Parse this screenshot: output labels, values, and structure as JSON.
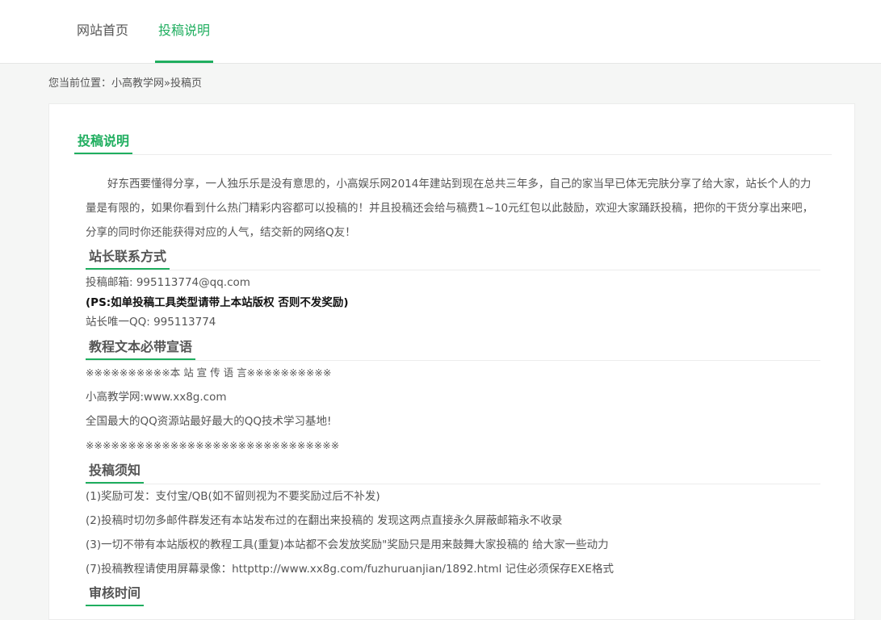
{
  "nav": {
    "items": [
      {
        "label": "网站首页",
        "active": false
      },
      {
        "label": "投稿说明",
        "active": true
      }
    ],
    "accent_color": "#1fae5f"
  },
  "breadcrumb": {
    "prefix": "您当前位置：",
    "home": "小高教学网",
    "separator": "»",
    "current": "投稿页"
  },
  "main_title": "投稿说明",
  "intro": "好东西要懂得分享，一人独乐乐是没有意思的，小高娱乐网2014年建站到现在总共三年多，自己的家当早已体无完肤分享了给大家，站长个人的力量是有限的，如果你看到什么热门精彩内容都可以投稿的！并且投稿还会给与稿费1~10元红包以此鼓励，欢迎大家踊跃投稿，把你的干货分享出来吧，分享的同时你还能获得对应的人气，结交新的网络Q友！",
  "contact": {
    "title": "站长联系方式",
    "email": "投稿邮箱: 995113774@qq.com",
    "note": "(PS:如单投稿工具类型请带上本站版权 否则不发奖励)",
    "qq": "站长唯一QQ: 995113774"
  },
  "slogan": {
    "title": "教程文本必带宣语",
    "line1": "※※※※※※※※※※本 站 宣 传 语 言※※※※※※※※※※",
    "line2": "小高教学网:www.xx8g.com",
    "line3": "全国最大的QQ资源站最好最大的QQ技术学习基地!",
    "line4": "※※※※※※※※※※※※※※※※※※※※※※※※※※※※※※"
  },
  "rules": {
    "title": "投稿须知",
    "items": [
      "(1)奖励可发：支付宝/QB(如不留则视为不要奖励过后不补发)",
      "(2)投稿时切勿多邮件群发还有本站发布过的在翻出来投稿的 发现这两点直接永久屏蔽邮箱永不收录",
      "(3)一切不带有本站版权的教程工具(重复)本站都不会发放奖励\"奖励只是用来鼓舞大家投稿的 给大家一些动力",
      "(7)投稿教程请使用屏幕录像：httpttp://www.xx8g.com/fuzhuruanjian/1892.html 记住必须保存EXE格式"
    ]
  },
  "review": {
    "title": "审核时间"
  }
}
